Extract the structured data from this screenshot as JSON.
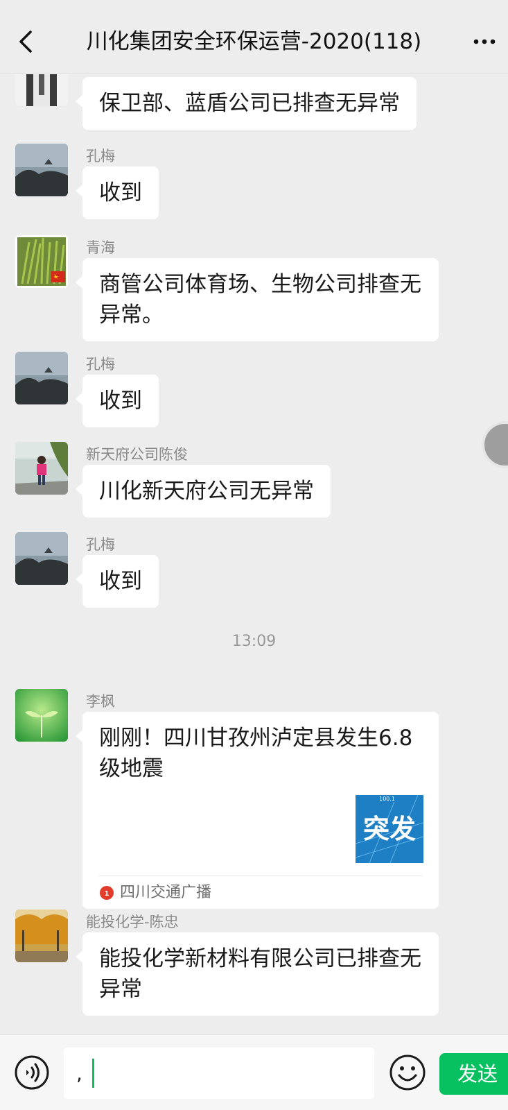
{
  "header": {
    "title": "川化集团安全环保运营-2020(118)",
    "back_icon": "chevron-left-icon",
    "more_icon": "more-dots-icon"
  },
  "messages": [
    {
      "sender": "",
      "text": "保卫部、蓝盾公司已排查无异常"
    },
    {
      "sender": "孔梅",
      "text": "收到"
    },
    {
      "sender": "青海",
      "text": "商管公司体育场、生物公司排查无异常。"
    },
    {
      "sender": "孔梅",
      "text": "收到"
    },
    {
      "sender": "新天府公司陈俊",
      "text": "川化新天府公司无异常"
    },
    {
      "sender": "孔梅",
      "text": "收到"
    }
  ],
  "timestamp": "13:09",
  "link_card": {
    "sender": "李枫",
    "title": "刚刚！四川甘孜州泸定县发生6.8级地震",
    "thumbnail_text": "突发",
    "source": "四川交通广播"
  },
  "last_message": {
    "sender": "能投化学-陈忠",
    "text": "能投化学新材料有限公司已排查无异常"
  },
  "input": {
    "value": ",",
    "send_label": "发送"
  },
  "colors": {
    "background": "#ededed",
    "bubble": "#ffffff",
    "accent": "#07c160"
  }
}
